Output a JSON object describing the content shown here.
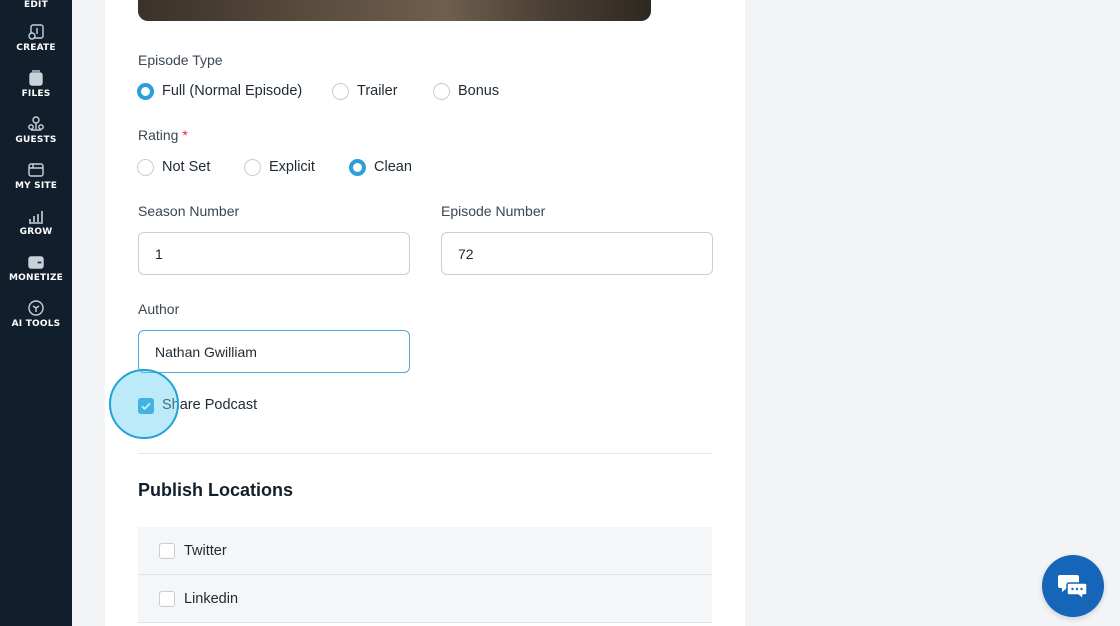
{
  "sidebar": {
    "items": [
      {
        "label": "EDIT",
        "icon": "edit-icon"
      },
      {
        "label": "CREATE",
        "icon": "music-note-icon"
      },
      {
        "label": "FILES",
        "icon": "files-icon"
      },
      {
        "label": "GUESTS",
        "icon": "guests-icon"
      },
      {
        "label": "MY SITE",
        "icon": "browser-icon"
      },
      {
        "label": "GROW",
        "icon": "bar-chart-icon"
      },
      {
        "label": "MONETIZE",
        "icon": "wallet-icon"
      },
      {
        "label": "AI TOOLS",
        "icon": "ai-icon"
      }
    ]
  },
  "form": {
    "episode_type": {
      "label": "Episode Type",
      "options": [
        "Full (Normal Episode)",
        "Trailer",
        "Bonus"
      ],
      "selected": "Full (Normal Episode)"
    },
    "rating": {
      "label": "Rating",
      "required_mark": "*",
      "options": [
        "Not Set",
        "Explicit",
        "Clean"
      ],
      "selected": "Clean"
    },
    "season_number": {
      "label": "Season Number",
      "value": "1"
    },
    "episode_number": {
      "label": "Episode Number",
      "value": "72"
    },
    "author": {
      "label": "Author",
      "value": "Nathan Gwilliam"
    },
    "share_podcast": {
      "label": "Share Podcast",
      "checked": true
    }
  },
  "publish_locations": {
    "title": "Publish Locations",
    "items": [
      {
        "label": "Twitter",
        "checked": false
      },
      {
        "label": "Linkedin",
        "checked": false
      }
    ]
  },
  "colors": {
    "accent": "#2b9fd8",
    "sidebar_bg": "#101f2b",
    "chat_button": "#1565b8",
    "required": "#e0293a"
  },
  "chat_widget": {
    "icon": "chat-bubbles-icon"
  }
}
